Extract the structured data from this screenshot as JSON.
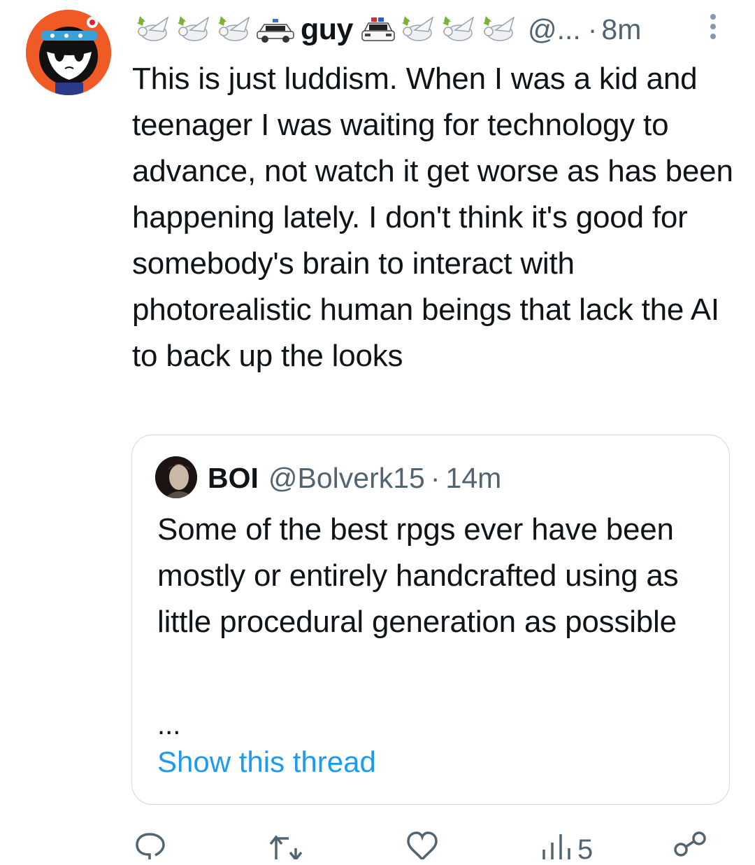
{
  "tweet": {
    "author_name": "guy",
    "handle": "@...",
    "separator": "·",
    "time": "8m",
    "text": "This is just luddism. When I was a kid and teenager I was waiting for technology to advance, not watch it get worse as has been happening lately.  I don't think it's good for somebody's brain to interact with photorealistic human beings that lack the AI to back up the looks",
    "name_emojis_before": [
      "dove-icon",
      "dove-icon",
      "dove-icon",
      "police-car-icon"
    ],
    "name_emojis_after": [
      "police-car-front-icon",
      "dove-icon",
      "dove-icon",
      "dove-icon"
    ]
  },
  "quote": {
    "author_name": "BOI",
    "handle": "@Bolverk15",
    "separator": "·",
    "time": "14m",
    "text": "Some of the best rpgs ever have been mostly or entirely handcrafted using as little procedural generation as possible",
    "ellipsis": "...",
    "show_thread_label": "Show this thread"
  },
  "actions": {
    "icons": [
      "reply-icon",
      "retweet-icon",
      "like-icon",
      "views-icon",
      "share-icon"
    ],
    "views_count": "5"
  },
  "colors": {
    "text": "#0f1419",
    "secondary": "#536471",
    "link": "#1d9bf0",
    "border": "#cfd9de",
    "avatar_bg": "#f05a24"
  }
}
